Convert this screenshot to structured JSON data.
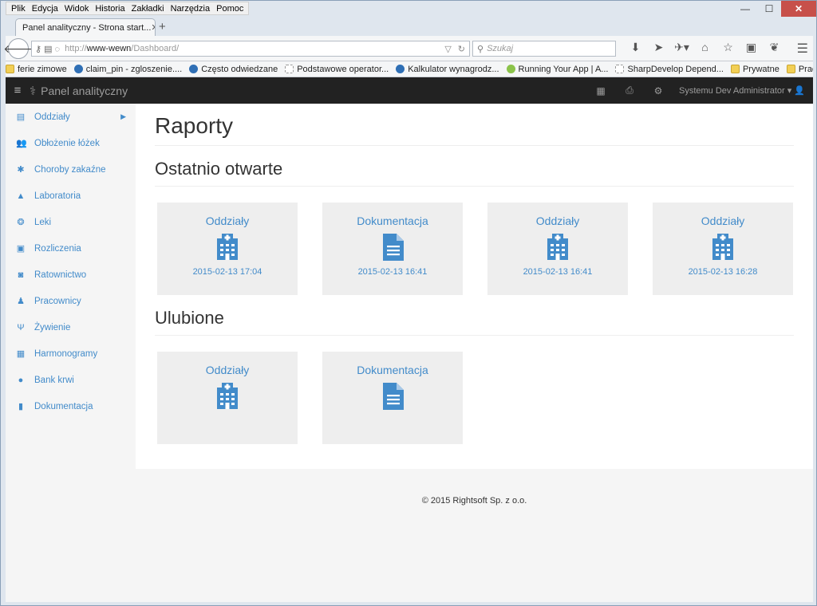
{
  "browser": {
    "menu": [
      "Plik",
      "Edycja",
      "Widok",
      "Historia",
      "Zakładki",
      "Narzędzia",
      "Pomoc"
    ],
    "tab_title": "Panel analityczny - Strona start...",
    "url_prefix": "http://",
    "url_host": "www-wewn",
    "url_path": "/Dashboard/",
    "search_placeholder": "Szukaj",
    "bookmarks": [
      {
        "label": "ferie zimowe",
        "icon": "folder"
      },
      {
        "label": "claim_pin - zgloszenie....",
        "icon": "blue"
      },
      {
        "label": "Często odwiedzane",
        "icon": "blue"
      },
      {
        "label": "Podstawowe operator...",
        "icon": "blank"
      },
      {
        "label": "Kalkulator wynagrodz...",
        "icon": "blue"
      },
      {
        "label": "Running Your App | A...",
        "icon": "green"
      },
      {
        "label": "SharpDevelop Depend...",
        "icon": "blank"
      },
      {
        "label": "Prywatne",
        "icon": "folder"
      },
      {
        "label": "Praca",
        "icon": "folder"
      }
    ]
  },
  "app": {
    "brand": "Panel analityczny",
    "user": "Systemu Dev Administrator"
  },
  "sidebar": {
    "items": [
      {
        "label": "Oddziały",
        "icon": "clipboard-icon",
        "glyph": "▤"
      },
      {
        "label": "Obłożenie łóżek",
        "icon": "users-icon",
        "glyph": "👥"
      },
      {
        "label": "Choroby zakaźne",
        "icon": "bug-icon",
        "glyph": "✱"
      },
      {
        "label": "Laboratoria",
        "icon": "flask-icon",
        "glyph": "▲"
      },
      {
        "label": "Leki",
        "icon": "pills-icon",
        "glyph": "❂"
      },
      {
        "label": "Rozliczenia",
        "icon": "money-icon",
        "glyph": "▣"
      },
      {
        "label": "Ratownictwo",
        "icon": "ambulance-icon",
        "glyph": "◙"
      },
      {
        "label": "Pracownicy",
        "icon": "user-md-icon",
        "glyph": "♟"
      },
      {
        "label": "Żywienie",
        "icon": "cutlery-icon",
        "glyph": "Ψ"
      },
      {
        "label": "Harmonogramy",
        "icon": "calendar-icon",
        "glyph": "▦"
      },
      {
        "label": "Bank krwi",
        "icon": "drop-icon",
        "glyph": "●"
      },
      {
        "label": "Dokumentacja",
        "icon": "file-icon",
        "glyph": "▮"
      }
    ]
  },
  "main": {
    "title": "Raporty",
    "recent_heading": "Ostatnio otwarte",
    "recent": [
      {
        "name": "Oddziały",
        "type": "hospital",
        "date": "2015-02-13 17:04"
      },
      {
        "name": "Dokumentacja",
        "type": "document",
        "date": "2015-02-13 16:41"
      },
      {
        "name": "Oddziały",
        "type": "hospital",
        "date": "2015-02-13 16:41"
      },
      {
        "name": "Oddziały",
        "type": "hospital",
        "date": "2015-02-13 16:28"
      }
    ],
    "favorites_heading": "Ulubione",
    "favorites": [
      {
        "name": "Oddziały",
        "type": "hospital"
      },
      {
        "name": "Dokumentacja",
        "type": "document"
      }
    ]
  },
  "footer": {
    "text": "© 2015 Rightsoft Sp. z o.o."
  },
  "colors": {
    "accent": "#428bca",
    "navbar": "#222222",
    "tile": "#eeeeee"
  }
}
